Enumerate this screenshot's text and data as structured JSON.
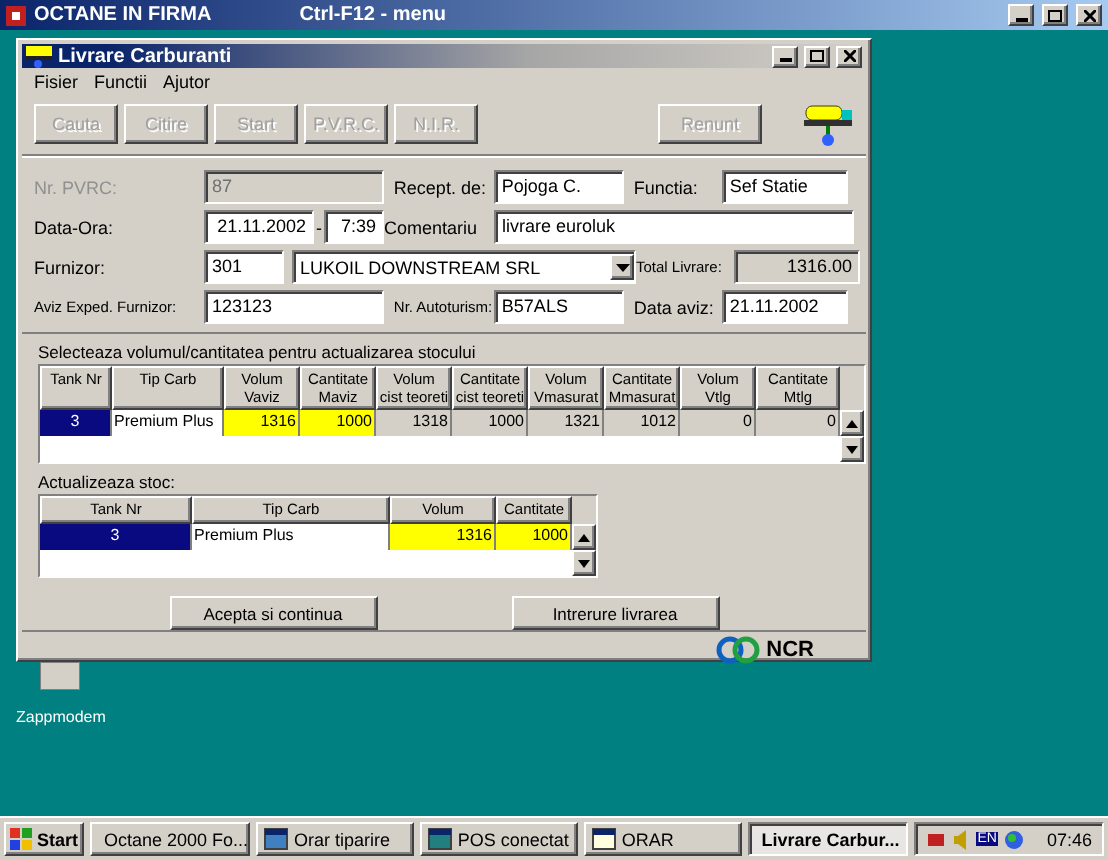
{
  "app_window": {
    "title": "OCTANE IN FIRMA",
    "hint": "Ctrl-F12 - menu"
  },
  "dialog": {
    "title": "Livrare Carburanti",
    "menu": [
      "Fisier",
      "Functii",
      "Ajutor"
    ],
    "toolbar": [
      {
        "label": "Cauta",
        "disabled": true
      },
      {
        "label": "Citire",
        "disabled": true
      },
      {
        "label": "Start",
        "disabled": true
      },
      {
        "label": "P.V.R.C.",
        "disabled": true
      },
      {
        "label": "N.I.R.",
        "disabled": true
      }
    ],
    "cancel": {
      "label": "Renunt",
      "disabled": true
    },
    "form": [
      [
        {
          "label": "Nr. PVRC:",
          "disabled": true,
          "fields": [
            {
              "kind": "disabled",
              "value": "87"
            }
          ]
        },
        {
          "label": "Recept. de:",
          "fields": [
            {
              "kind": "input",
              "value": "Pojoga C."
            }
          ]
        },
        {
          "label": "Functia:",
          "fields": [
            {
              "kind": "input",
              "value": "Sef Statie"
            }
          ]
        }
      ],
      [
        {
          "label": "Data-Ora:",
          "fields": [
            {
              "kind": "number",
              "value": "21.11.2002"
            },
            {
              "kind": "sep",
              "value": "-"
            },
            {
              "kind": "number",
              "value": "7:39"
            }
          ]
        },
        {
          "label": "Comentariu",
          "fields": [
            {
              "kind": "input",
              "value": "livrare euroluk"
            }
          ]
        }
      ],
      [
        {
          "label": "Furnizor:",
          "fields": [
            {
              "kind": "input",
              "value": "301"
            },
            {
              "kind": "combo",
              "value": "LUKOIL DOWNSTREAM SRL"
            }
          ]
        },
        {
          "label": "Total Livrare:",
          "fields": [
            {
              "kind": "readonly",
              "value": "1316.00"
            }
          ]
        }
      ],
      [
        {
          "label": "Aviz Exped. Furnizor:",
          "fields": [
            {
              "kind": "input",
              "value": "123123"
            }
          ]
        },
        {
          "label": "Nr. Autoturism:",
          "fields": [
            {
              "kind": "input",
              "value": "B57ALS"
            }
          ]
        },
        {
          "label": "Data aviz:",
          "fields": [
            {
              "kind": "input",
              "value": "21.11.2002"
            }
          ]
        }
      ]
    ],
    "stock_select": {
      "caption": "Selecteaza volumul/cantitatea pentru actualizarea stocului",
      "columns": [
        {
          "lines": [
            "Tank Nr"
          ]
        },
        {
          "lines": [
            "Tip Carb"
          ]
        },
        {
          "lines": [
            "Volum",
            "Vaviz"
          ]
        },
        {
          "lines": [
            "Cantitate",
            "Maviz"
          ]
        },
        {
          "lines": [
            "Volum",
            "cist teoreti"
          ]
        },
        {
          "lines": [
            "Cantitate",
            "cist teoreti"
          ]
        },
        {
          "lines": [
            "Volum",
            "Vmasurat"
          ]
        },
        {
          "lines": [
            "Cantitate",
            "Mmasurat"
          ]
        },
        {
          "lines": [
            "Volum",
            "Vtlg"
          ]
        },
        {
          "lines": [
            "Cantitate",
            "Mtlg"
          ]
        }
      ],
      "rows": [
        [
          {
            "kind": "selected",
            "value": "3"
          },
          {
            "kind": "text",
            "value": "Premium Plus"
          },
          {
            "kind": "edit",
            "value": "1316"
          },
          {
            "kind": "edit",
            "value": "1000"
          },
          {
            "kind": "readonly",
            "value": "1318"
          },
          {
            "kind": "readonly",
            "value": "1000"
          },
          {
            "kind": "readonly",
            "value": "1321"
          },
          {
            "kind": "readonly",
            "value": "1012"
          },
          {
            "kind": "readonly",
            "value": "0"
          },
          {
            "kind": "readonly",
            "value": "0"
          }
        ]
      ]
    },
    "stock_update": {
      "caption": "Actualizeaza stoc:",
      "columns": [
        {
          "lines": [
            "Tank Nr"
          ]
        },
        {
          "lines": [
            "Tip Carb"
          ]
        },
        {
          "lines": [
            "Volum"
          ]
        },
        {
          "lines": [
            "Cantitate"
          ]
        }
      ],
      "rows": [
        [
          {
            "kind": "selected",
            "value": "3"
          },
          {
            "kind": "text",
            "value": "Premium Plus"
          },
          {
            "kind": "edit",
            "value": "1316"
          },
          {
            "kind": "edit",
            "value": "1000"
          }
        ]
      ]
    },
    "actions": [
      "Acepta si continua",
      "Intrerure livrarea"
    ],
    "brand": "NCR"
  },
  "desktop_icon": {
    "label": "Zappmodem"
  },
  "taskbar": {
    "start": "Start",
    "items": [
      {
        "label": "Octane 2000 Fo...",
        "selected": false
      },
      {
        "label": "Orar tiparire",
        "selected": false
      },
      {
        "label": "POS conectat",
        "selected": false
      },
      {
        "label": "ORAR",
        "selected": false
      },
      {
        "label": "Livrare Carbur...",
        "selected": true
      }
    ],
    "language": "EN",
    "clock": "07:46"
  }
}
